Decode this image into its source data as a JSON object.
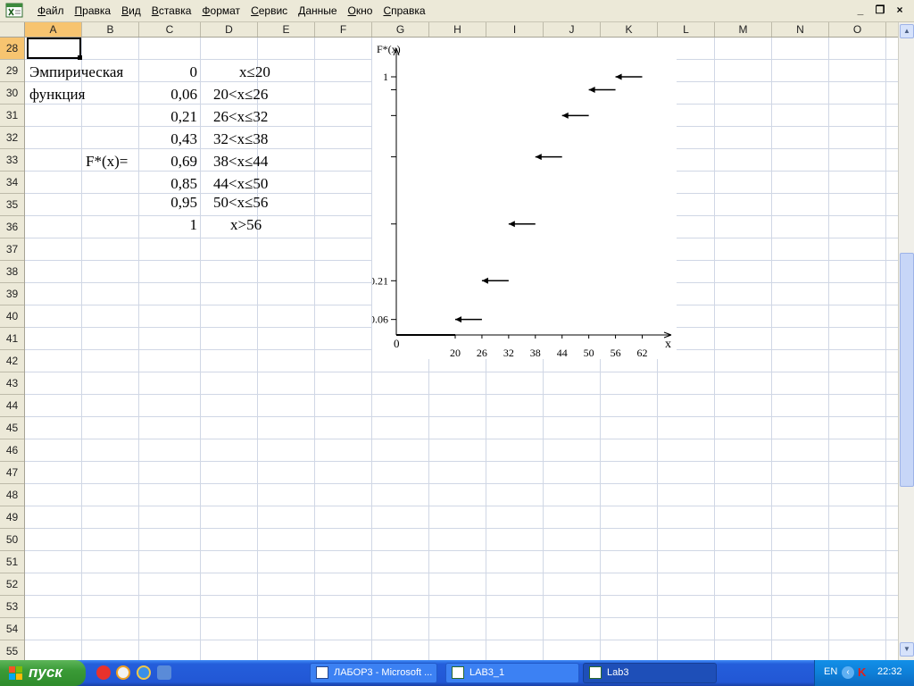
{
  "menu": {
    "items": [
      "Файл",
      "Правка",
      "Вид",
      "Вставка",
      "Формат",
      "Сервис",
      "Данные",
      "Окно",
      "Справка"
    ],
    "window_controls": [
      "_",
      "❐",
      "×"
    ]
  },
  "sheet": {
    "columns": [
      "A",
      "B",
      "C",
      "D",
      "E",
      "F",
      "G",
      "H",
      "I",
      "J",
      "K",
      "L",
      "M",
      "N",
      "O"
    ],
    "active_column": "A",
    "rows": [
      "28",
      "29",
      "30",
      "31",
      "32",
      "33",
      "34",
      "35",
      "36",
      "37",
      "38",
      "39",
      "40",
      "41",
      "42",
      "43",
      "44",
      "45",
      "46",
      "47",
      "48",
      "49",
      "50",
      "51",
      "52",
      "53",
      "54",
      "55"
    ],
    "active_row": "28",
    "cells": {
      "a29": "Эмпирическая",
      "a30": "функция",
      "b33": "F*(x)=",
      "values": [
        "0",
        "0,06",
        "0,21",
        "0,43",
        "0,69",
        "0,85",
        "0,95",
        "1"
      ],
      "intervals": [
        "x≤20",
        "20<x≤26",
        "26<x≤32",
        "32<x≤38",
        "38<x≤44",
        "44<x≤50",
        "50<x≤56",
        "x>56"
      ]
    }
  },
  "chart_data": {
    "type": "line",
    "ylabel": "F*(x)",
    "xlabel": "x",
    "origin_label": "0",
    "x_ticks": [
      20,
      26,
      32,
      38,
      44,
      50,
      56,
      62
    ],
    "y_tick_labels": [
      {
        "value": 0.06,
        "label": "0.06"
      },
      {
        "value": 0.21,
        "label": "0.21"
      },
      {
        "value": 1,
        "label": "1"
      }
    ],
    "segments": [
      {
        "x_from": 0,
        "x_to": 20,
        "y": 0,
        "arrow": false
      },
      {
        "x_from": 20,
        "x_to": 26,
        "y": 0.06,
        "arrow": true
      },
      {
        "x_from": 26,
        "x_to": 32,
        "y": 0.21,
        "arrow": true
      },
      {
        "x_from": 32,
        "x_to": 38,
        "y": 0.43,
        "arrow": true
      },
      {
        "x_from": 38,
        "x_to": 44,
        "y": 0.69,
        "arrow": true
      },
      {
        "x_from": 44,
        "x_to": 50,
        "y": 0.85,
        "arrow": true
      },
      {
        "x_from": 50,
        "x_to": 56,
        "y": 0.95,
        "arrow": true
      },
      {
        "x_from": 56,
        "x_to": 62,
        "y": 1,
        "arrow": true
      }
    ]
  },
  "taskbar": {
    "start_label": "пуск",
    "quick_launch": [
      "skype-icon",
      "media-player-icon",
      "internet-explorer-icon",
      "show-desktop-icon"
    ],
    "tasks": [
      {
        "label": "ЛАБОР3 - Microsoft ...",
        "icon": "word-icon",
        "active": false
      },
      {
        "label": "LAB3_1",
        "icon": "excel-icon",
        "active": false
      },
      {
        "label": "Lab3",
        "icon": "excel-icon",
        "active": true
      }
    ],
    "tray": {
      "language": "EN",
      "time": "22:32"
    }
  }
}
